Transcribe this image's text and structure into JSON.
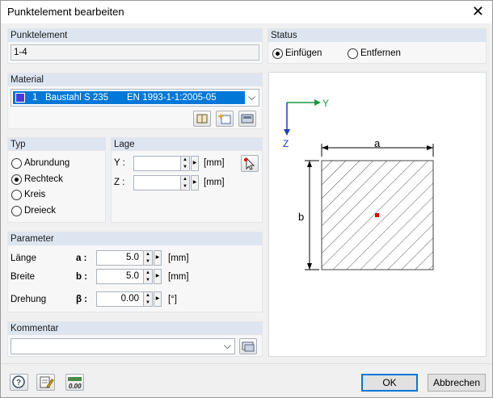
{
  "window": {
    "title": "Punktelement bearbeiten"
  },
  "punktelement": {
    "header": "Punktelement",
    "value": "1-4"
  },
  "status": {
    "header": "Status",
    "options": [
      {
        "label": "Einfügen",
        "selected": true
      },
      {
        "label": "Entfernen",
        "selected": false
      }
    ]
  },
  "material": {
    "header": "Material",
    "number": "1",
    "name": "Baustahl S 235",
    "norm": "EN 1993-1-1:2005-05",
    "color": "#4a3bd9"
  },
  "typ": {
    "header": "Typ",
    "options": [
      {
        "label": "Abrundung",
        "selected": false
      },
      {
        "label": "Rechteck",
        "selected": true
      },
      {
        "label": "Kreis",
        "selected": false
      },
      {
        "label": "Dreieck",
        "selected": false
      }
    ]
  },
  "lage": {
    "header": "Lage",
    "y_label": "Y :",
    "z_label": "Z :",
    "y_value": "",
    "z_value": "",
    "unit": "[mm]"
  },
  "parameter": {
    "header": "Parameter",
    "rows": [
      {
        "label": "Länge",
        "symbol": "a :",
        "value": "5.0",
        "unit": "[mm]"
      },
      {
        "label": "Breite",
        "symbol": "b :",
        "value": "5.0",
        "unit": "[mm]"
      },
      {
        "label": "Drehung",
        "symbol": "β :",
        "value": "0.00",
        "unit": "[°]"
      }
    ]
  },
  "kommentar": {
    "header": "Kommentar",
    "value": ""
  },
  "diagram": {
    "axis_y": "Y",
    "axis_z": "Z",
    "dim_a": "a",
    "dim_b": "b"
  },
  "footer": {
    "ok": "OK",
    "cancel": "Abbrechen",
    "units_icon_text": "0.00"
  },
  "colors": {
    "header_bg": "#dde5f0",
    "accent": "#0078d7",
    "axis_y": "#1a9a3a",
    "axis_z": "#1f3fbf",
    "center_point": "#e00000"
  }
}
